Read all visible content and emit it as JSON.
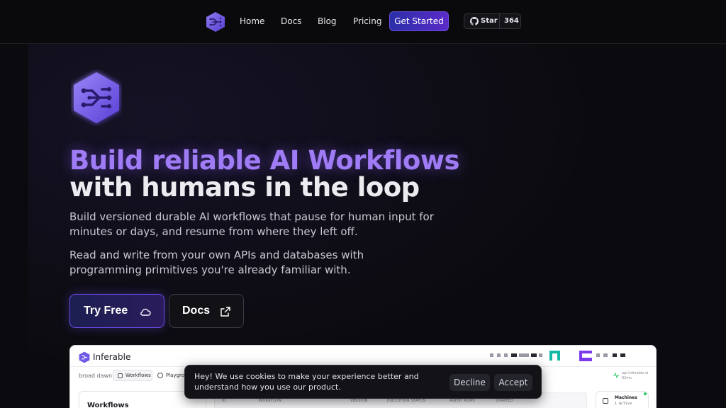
{
  "nav": {
    "items": [
      {
        "label": "Home"
      },
      {
        "label": "Docs"
      },
      {
        "label": "Blog"
      },
      {
        "label": "Pricing"
      }
    ],
    "cta_label": "Get Started",
    "github_star_label": "Star",
    "github_star_count": "364"
  },
  "hero": {
    "title_line1": "Build reliable AI Workflows",
    "title_line2": "with humans in the loop",
    "paragraph1": "Build versioned durable AI workflows that pause for human input for minutes or days, and resume from where they left off.",
    "paragraph2": "Read and write from your own APIs and databases with programming primitives you're already familiar with.",
    "try_free_label": "Try Free",
    "docs_label": "Docs"
  },
  "app_preview": {
    "app_name": "Inferable",
    "cluster_name": "broad dawn",
    "tabs": [
      {
        "label": "Workflows"
      },
      {
        "label": "Playground"
      }
    ],
    "api_status_line1": "api.inferable.ai",
    "api_status_line2": "82ms",
    "workflows_heading": "Workflows",
    "table_headers": [
      "ID",
      "WORKFLOW",
      "VERSION",
      "EXECUTION STATUS",
      "AGENT RUNS",
      "STARTED"
    ],
    "machines_title": "Machines",
    "machines_count": "1 Active"
  },
  "cookie_banner": {
    "message": "Hey! We use cookies to make your experience better and understand how you use our product.",
    "decline_label": "Decline",
    "accept_label": "Accept"
  },
  "colors": {
    "accent_purple": "#9f7bf5",
    "button_gradient_start": "#2a2fa8",
    "button_gradient_end": "#5b2bc8",
    "background": "#0b0b0f"
  }
}
